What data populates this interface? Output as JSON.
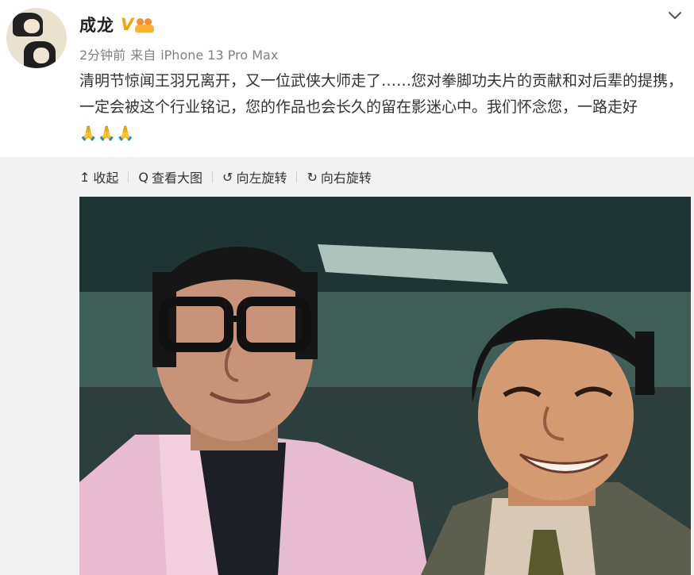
{
  "post": {
    "author": "成龙",
    "verified_badge": "V",
    "time": "2分钟前",
    "source_prefix": "来自",
    "device": "iPhone 13 Pro Max",
    "text": "清明节惊闻王羽兄离开，又一位武侠大师走了……您对拳脚功夫片的贡献和对后辈的提携，一定会被这个行业铭记，您的作品也会长久的留在影迷心中。我们怀念您，一路走好",
    "emoji": "🙏🙏🙏"
  },
  "toolbar": {
    "collapse": "收起",
    "view_large": "查看大图",
    "rotate_left": "向左旋转",
    "rotate_right": "向右旋转"
  },
  "icons": {
    "collapse": "↥",
    "view_large": "Q",
    "rotate_left": "↺",
    "rotate_right": "↻"
  },
  "colors": {
    "verified": "#f6a500",
    "meta_gray": "#808080",
    "panel_bg": "#f2f2f2"
  }
}
